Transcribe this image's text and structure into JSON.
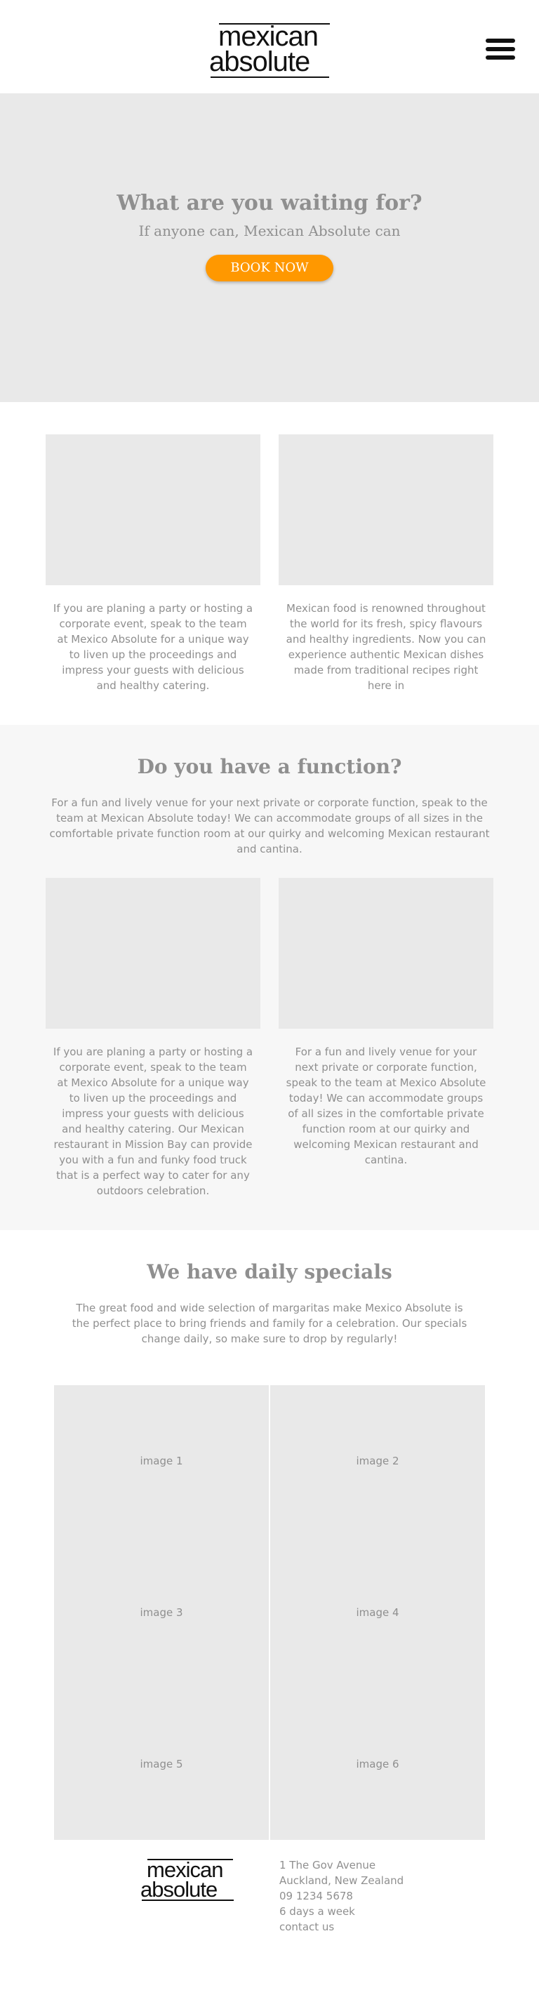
{
  "header": {
    "logo_line1": "mexican",
    "logo_line2": "absolute",
    "menu_icon": "hamburger-menu-icon"
  },
  "hero": {
    "title": "What are you waiting for?",
    "subtitle": "If anyone can, Mexican Absolute can",
    "button_label": "BOOK NOW",
    "button_color": "#ff9800"
  },
  "intro_cards": [
    {
      "text": "If you are planing a party or hosting a corporate event, speak to the team at Mexico Absolute for a unique way to liven up the proceedings and impress your guests with delicious and healthy catering."
    },
    {
      "text": "Mexican food is renowned throughout the world for its fresh, spicy flavours and healthy ingredients. Now you can experience authentic Mexican dishes made from traditional recipes right here in"
    }
  ],
  "function": {
    "title": "Do you have a function?",
    "description": "For a fun and lively venue for your next private or corporate function, speak to the team at Mexican Absolute today! We can accommodate groups of all sizes in the comfortable private function room at our quirky and welcoming Mexican restaurant and cantina.",
    "cards": [
      {
        "text": "If you are planing a party or hosting a corporate event, speak to the team at Mexico Absolute for a unique way to liven up the proceedings and impress your guests with delicious and healthy catering. Our Mexican restaurant in Mission Bay can provide you with a fun and funky food truck that is a perfect way to cater for any outdoors celebration."
      },
      {
        "text": "For a fun and lively venue for your next private or corporate function, speak to the team at Mexico Absolute today! We can accommodate groups of all sizes in the comfortable private function room at our quirky and welcoming Mexican restaurant and cantina."
      }
    ]
  },
  "specials": {
    "title": "We have daily specials",
    "description": "The great food and wide selection of margaritas make Mexico Absolute is the perfect place to bring friends and family for a celebration. Our specials change daily, so make sure to drop by regularly!",
    "images": [
      "image 1",
      "image 2",
      "image 3",
      "image 4",
      "image 5",
      "image 6"
    ]
  },
  "footer": {
    "logo_line1": "mexican",
    "logo_line2": "absolute",
    "address_line1": "1 The Gov Avenue",
    "address_line2": "Auckland, New Zealand",
    "phone": "09 1234 5678",
    "hours": "6 days a week",
    "contact_link": "contact us"
  }
}
